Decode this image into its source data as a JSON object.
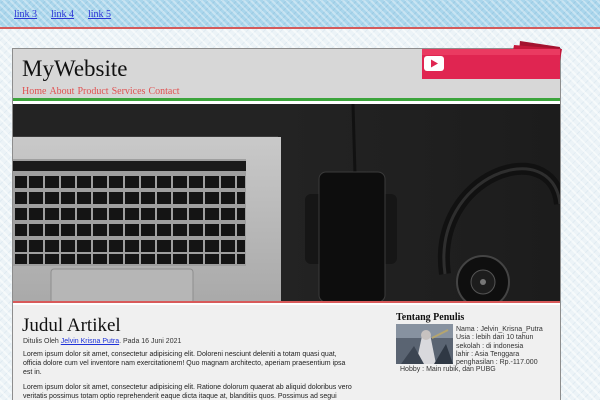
{
  "topnav": {
    "links": [
      "link 3",
      "link 4",
      "link 5"
    ]
  },
  "header": {
    "site_title": "MyWebsite",
    "menu": [
      "Home",
      "About",
      "Product",
      "Services",
      "Contact"
    ]
  },
  "article": {
    "title": "Judul Artikel",
    "byline_prefix": "Ditulis Oleh",
    "author_link": "Jelvin Krisna Putra",
    "byline_date": ". Pada 16 Juni 2021",
    "paragraphs": [
      "Lorem ipsum dolor sit amet, consectetur adipisicing elit. Doloreni nesciunt deleniti a totam quasi quat, officia dolore cum vel inventore nam exercitationem! Quo magnam architecto, aperiam praesentium ipsa est in.",
      "Lorem ipsum dolor sit amet, consectetur adipisicing elit. Ratione dolorum quaerat ab aliquid doloribus vero veritatis possimus totam optio reprehenderit eaque dicta itaque at, blanditiis quos. Possimus ad segui"
    ]
  },
  "sidebar": {
    "title": "Tentang Penulis",
    "info": [
      "Nama : Jelvin_Krisna_Putra",
      "Usia : lebih dari 10 tahun",
      "sekolah : di indonesia",
      "lahir : Asia Tenggara",
      "penghasilan : Rp.-117.000"
    ],
    "hobby": "Hobby : Main rubik, dan PUBG"
  },
  "colors": {
    "topnav_bg": "#aad6ec",
    "menu_text": "#e05252",
    "header_border": "#3ca43c",
    "hero_border": "#d85a5a",
    "link": "#1e32d8"
  },
  "icons": {
    "banner": "youtube-icon"
  }
}
